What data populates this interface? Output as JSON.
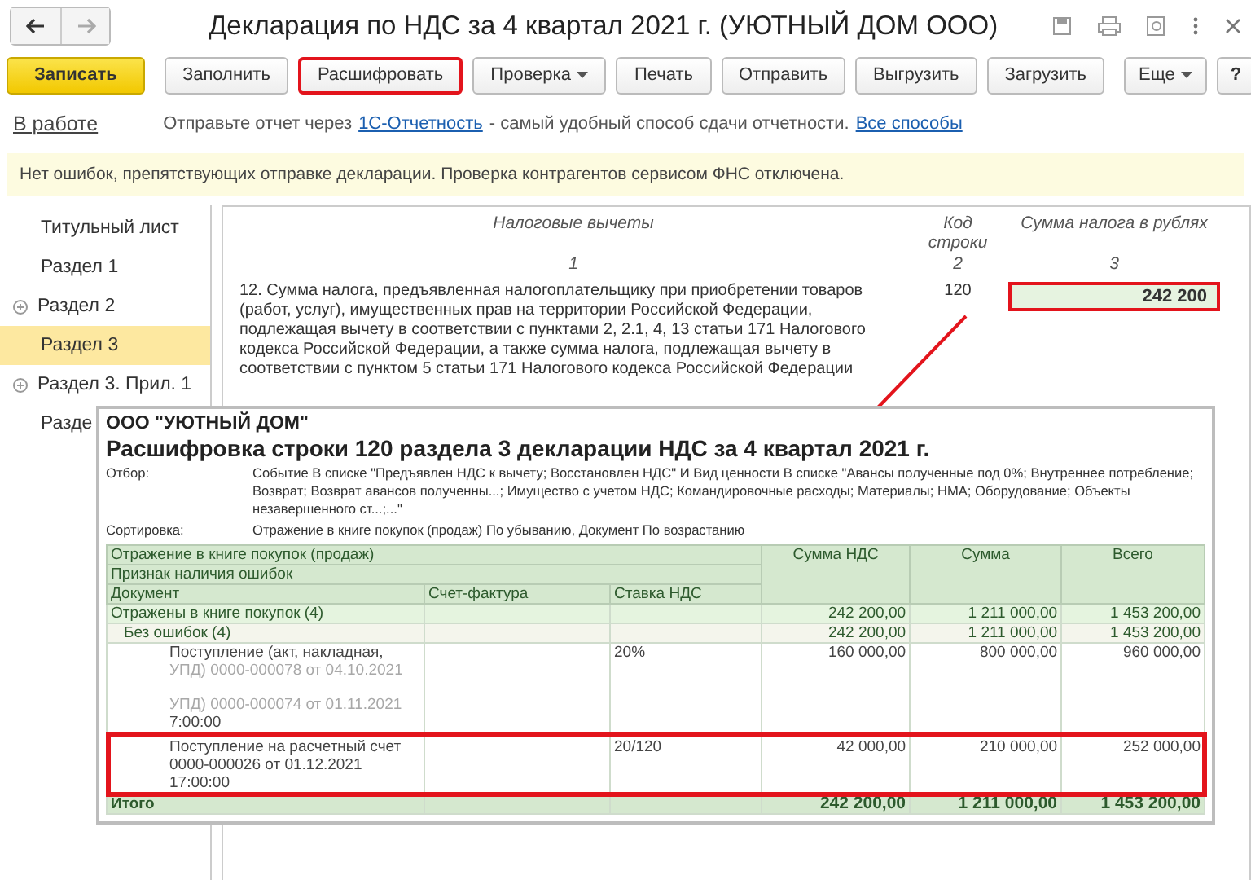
{
  "window": {
    "title": "Декларация по НДС за 4 квартал 2021 г. (УЮТНЫЙ ДОМ ООО)"
  },
  "toolbar": {
    "primary": "Записать",
    "buttons": [
      {
        "label": "Заполнить",
        "highlighted": false,
        "dropdown": false
      },
      {
        "label": "Расшифровать",
        "highlighted": true,
        "dropdown": false
      },
      {
        "label": "Проверка",
        "highlighted": false,
        "dropdown": true
      },
      {
        "label": "Печать",
        "highlighted": false,
        "dropdown": false
      },
      {
        "label": "Отправить",
        "highlighted": false,
        "dropdown": false
      },
      {
        "label": "Выгрузить",
        "highlighted": false,
        "dropdown": false
      },
      {
        "label": "Загрузить",
        "highlighted": false,
        "dropdown": false
      }
    ],
    "more": "Еще",
    "help": "?"
  },
  "status": {
    "state": "В работе",
    "text_before": "Отправьте отчет через",
    "link": "1С-Отчетность",
    "text_after": "- самый удобный способ сдачи отчетности.",
    "link2": "Все способы"
  },
  "message": "Нет ошибок, препятствующих отправке декларации. Проверка контрагентов сервисом ФНС отключена.",
  "sidebar": {
    "items": [
      {
        "label": "Титульный лист",
        "selected": false,
        "expandable": false
      },
      {
        "label": "Раздел 1",
        "selected": false,
        "expandable": false
      },
      {
        "label": "Раздел 2",
        "selected": false,
        "expandable": true
      },
      {
        "label": "Раздел 3",
        "selected": true,
        "expandable": false
      },
      {
        "label": "Раздел 3. Прил. 1",
        "selected": false,
        "expandable": true
      },
      {
        "label": "Разде",
        "selected": false,
        "expandable": false
      }
    ]
  },
  "form": {
    "col_headers": [
      "Налоговые вычеты",
      "Код строки",
      "Сумма налога в рублях"
    ],
    "col_numbers": [
      "1",
      "2",
      "3"
    ],
    "line": {
      "text": "12. Сумма налога, предъявленная налогоплательщику при приобретении товаров (работ, услуг), имущественных прав на территории Российской Федерации, подлежащая вычету в соответствии с пунктами 2, 2.1, 4, 13 статьи 171 Налогового кодекса Российской Федерации, а также сумма налога, подлежащая вычету в соответствии с пунктом 5 статьи 171 Налогового кодекса Российской Федерации",
      "code": "120",
      "value": "242 200",
      "highlighted": true
    }
  },
  "report": {
    "company": "ООО \"УЮТНЫЙ ДОМ\"",
    "title": "Расшифровка строки 120 раздела 3 декларации НДС за 4 квартал 2021 г.",
    "params": [
      {
        "label": "Отбор:",
        "value": "Событие В списке \"Предъявлен НДС к вычету; Восстановлен НДС\" И Вид ценности В списке \"Авансы полученные под 0%; Внутреннее потребление; Возврат; Возврат авансов полученны...; Имущество с учетом НДС; Командировочные расходы; Материалы; НМА; Оборудование; Объекты незавершенного ст...;...\""
      },
      {
        "label": "Сортировка:",
        "value": "Отражение в книге покупок (продаж) По убыванию, Документ По возрастанию"
      }
    ],
    "group_headers": [
      "Отражение в книге покупок (продаж)",
      "Признак наличия ошибок"
    ],
    "columns": [
      "Документ",
      "Счет-фактура",
      "Ставка НДС",
      "Сумма НДС",
      "Сумма",
      "Всего"
    ],
    "rows": [
      {
        "kind": "group",
        "cells": [
          "Отражены в книге покупок (4)",
          "",
          "",
          "242 200,00",
          "1 211 000,00",
          "1 453 200,00"
        ],
        "highlighted": false
      },
      {
        "kind": "subgroup",
        "cells": [
          "Без ошибок (4)",
          "",
          "",
          "242 200,00",
          "1 211 000,00",
          "1 453 200,00"
        ],
        "highlighted": false
      },
      {
        "kind": "detail",
        "lines": [
          {
            "text": "Поступление (акт, накладная,",
            "faded": false
          },
          {
            "text": "УПД) 0000-000078 от 04.10.2021",
            "faded": true
          },
          {
            "text": "УПД) 0000-000074 от 01.11.2021",
            "faded": true
          },
          {
            "text": "7:00:00",
            "faded": false
          }
        ],
        "cells": [
          "",
          "",
          "20%",
          "160 000,00",
          "800 000,00",
          "960 000,00"
        ],
        "highlighted": false
      },
      {
        "kind": "detail",
        "lines": [
          {
            "text": "Поступление на расчетный счет",
            "faded": false
          },
          {
            "text": "0000-000026 от 01.12.2021",
            "faded": false
          },
          {
            "text": "17:00:00",
            "faded": false
          }
        ],
        "cells": [
          "",
          "",
          "20/120",
          "42 000,00",
          "210 000,00",
          "252 000,00"
        ],
        "highlighted": true
      },
      {
        "kind": "total",
        "cells": [
          "Итого",
          "",
          "",
          "242 200,00",
          "1 211 000,00",
          "1 453 200,00"
        ],
        "highlighted": false
      }
    ]
  }
}
